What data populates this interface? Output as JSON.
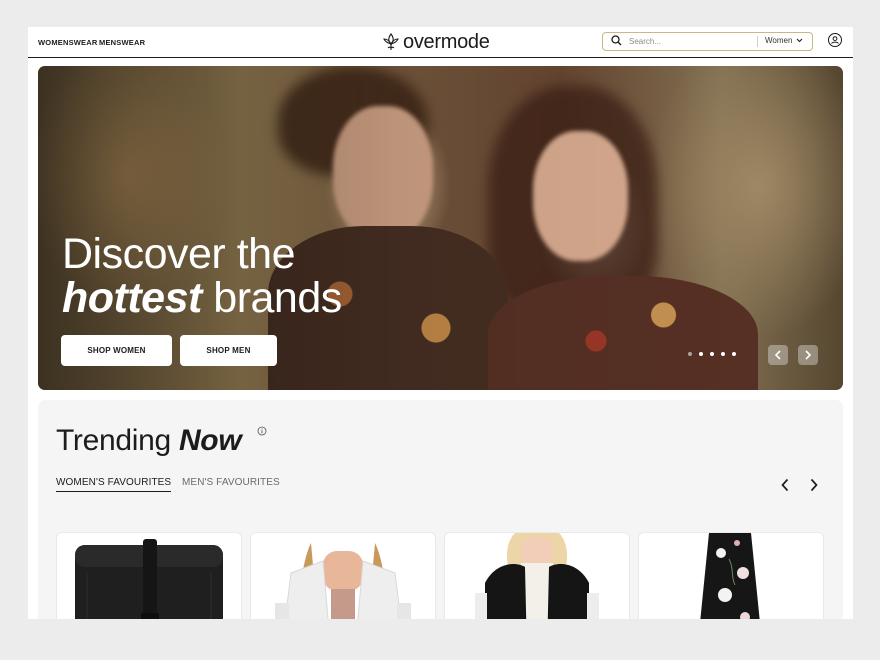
{
  "header": {
    "nav": [
      "WOMENSWEAR",
      "MENSWEAR"
    ],
    "logo_text": "overmode",
    "search": {
      "placeholder": "Search...",
      "category": "Women"
    }
  },
  "hero": {
    "title_line1": "Discover the",
    "title_em": "hottest",
    "title_rest": " brands",
    "buttons": [
      "SHOP WOMEN",
      "SHOP MEN"
    ],
    "slides": {
      "count": 5,
      "active": 1
    }
  },
  "trending": {
    "title": "Trending",
    "title_em": "Now",
    "tabs": [
      "WOMEN'S FAVOURITES",
      "MEN'S FAVOURITES"
    ],
    "active_tab": 0,
    "products": [
      {
        "name": "black-backpack"
      },
      {
        "name": "white-denim-jacket"
      },
      {
        "name": "black-faux-fur-vest"
      },
      {
        "name": "floral-print-skirt"
      }
    ]
  },
  "colors": {
    "accent_border": "#c8b887",
    "text": "#1c1c1c",
    "panel": "#f5f5f5"
  }
}
